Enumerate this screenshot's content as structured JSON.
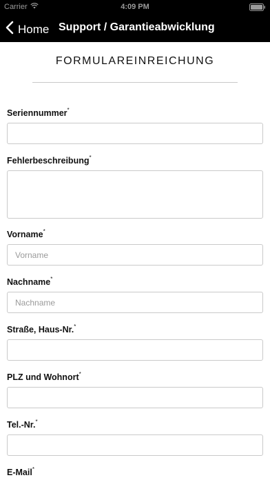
{
  "status_bar": {
    "carrier": "Carrier",
    "time": "4:09 PM",
    "wifi_icon": "wifi-icon"
  },
  "nav": {
    "back_label": "Home",
    "title": "Support / Garantieabwicklung",
    "back_icon": "chevron-left-icon"
  },
  "form": {
    "title": "FORMULAREINREICHUNG",
    "required_mark": "*",
    "fields": [
      {
        "label": "Seriennummer",
        "placeholder": "",
        "value": ""
      },
      {
        "label": "Fehlerbeschreibung",
        "placeholder": "",
        "value": ""
      },
      {
        "label": "Vorname",
        "placeholder": "Vorname",
        "value": ""
      },
      {
        "label": "Nachname",
        "placeholder": "Nachname",
        "value": ""
      },
      {
        "label": "Straße, Haus-Nr.",
        "placeholder": "",
        "value": ""
      },
      {
        "label": "PLZ und Wohnort",
        "placeholder": "",
        "value": ""
      },
      {
        "label": "Tel.-Nr.",
        "placeholder": "",
        "value": ""
      },
      {
        "label": "E-Mail",
        "placeholder": "",
        "value": ""
      }
    ]
  }
}
